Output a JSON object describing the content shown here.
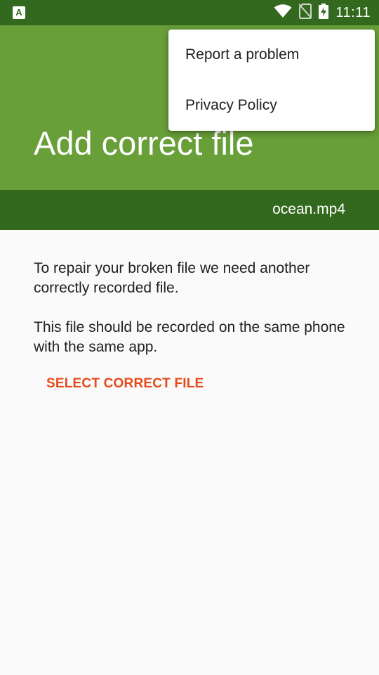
{
  "status_bar": {
    "app_icon_letter": "A",
    "time": "11:11",
    "icons": [
      "wifi-icon",
      "no-sim-icon",
      "battery-charging-icon"
    ]
  },
  "header": {
    "title": "Add correct file",
    "file_name": "ocean.mp4"
  },
  "content": {
    "paragraph_1": "To repair your broken file we need another correctly recorded file.",
    "paragraph_2": "This file should be recorded on the same phone with the same app.",
    "select_button_label": "SELECT CORRECT FILE"
  },
  "overflow_menu": {
    "items": [
      {
        "label": "Report a problem"
      },
      {
        "label": "Privacy Policy"
      }
    ]
  },
  "colors": {
    "app_bar": "#689f38",
    "status_bar": "#33691e",
    "accent": "#e64a19"
  }
}
